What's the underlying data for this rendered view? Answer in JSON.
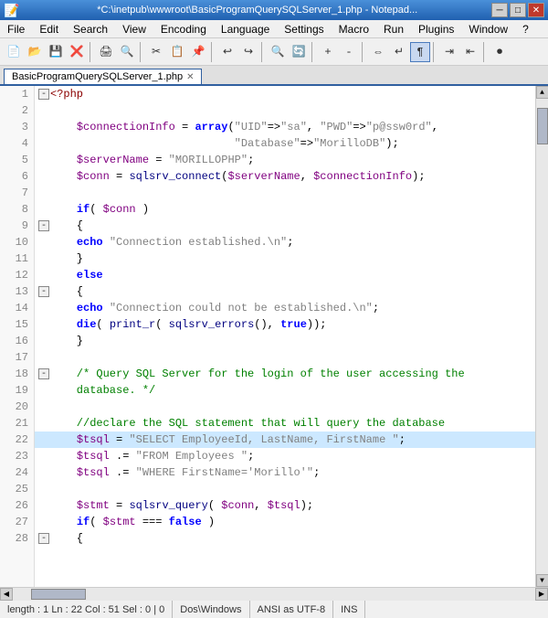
{
  "titleBar": {
    "title": "*C:\\inetpub\\wwwroot\\BasicProgramQuerySQLServer_1.php - Notepad...",
    "minimizeLabel": "─",
    "maximizeLabel": "□",
    "closeLabel": "✕"
  },
  "menuBar": {
    "items": [
      "File",
      "Edit",
      "Search",
      "View",
      "Encoding",
      "Language",
      "Settings",
      "Macro",
      "Run",
      "Plugins",
      "Window",
      "?"
    ]
  },
  "tab": {
    "label": "BasicProgramQuerySQLServer_1.php",
    "closeLabel": "✕"
  },
  "statusBar": {
    "position": "length : 1   Ln : 22   Col : 51   Sel : 0 | 0",
    "lineEnding": "Dos\\Windows",
    "encoding": "ANSI as UTF-8",
    "mode": "INS"
  },
  "lines": [
    {
      "num": 1,
      "fold": "-",
      "code": "<?php",
      "type": "tag"
    },
    {
      "num": 2,
      "fold": "",
      "code": "",
      "type": "plain"
    },
    {
      "num": 3,
      "fold": "",
      "code": "    $connectionInfo = array(\"UID\"=>\"sa\", \"PWD\"=>\"p@ssw0rd\",",
      "type": "mixed"
    },
    {
      "num": 4,
      "fold": "",
      "code": "                            \"Database\"=>\"MorilloDB\");",
      "type": "mixed"
    },
    {
      "num": 5,
      "fold": "",
      "code": "    $serverName = \"MORILLOPHP\";",
      "type": "mixed"
    },
    {
      "num": 6,
      "fold": "",
      "code": "    $conn = sqlsrv_connect($serverName, $connectionInfo);",
      "type": "mixed"
    },
    {
      "num": 7,
      "fold": "",
      "code": "",
      "type": "plain"
    },
    {
      "num": 8,
      "fold": "",
      "code": "    if( $conn )",
      "type": "mixed"
    },
    {
      "num": 9,
      "fold": "-",
      "code": "    {",
      "type": "plain"
    },
    {
      "num": 10,
      "fold": "",
      "code": "    echo \"Connection established.\\n\";",
      "type": "mixed"
    },
    {
      "num": 11,
      "fold": "",
      "code": "    }",
      "type": "plain"
    },
    {
      "num": 12,
      "fold": "",
      "code": "    else",
      "type": "kw"
    },
    {
      "num": 13,
      "fold": "-",
      "code": "    {",
      "type": "plain"
    },
    {
      "num": 14,
      "fold": "",
      "code": "    echo \"Connection could not be established.\\n\";",
      "type": "mixed"
    },
    {
      "num": 15,
      "fold": "",
      "code": "    die( print_r( sqlsrv_errors(), true));",
      "type": "mixed"
    },
    {
      "num": 16,
      "fold": "",
      "code": "    }",
      "type": "plain"
    },
    {
      "num": 17,
      "fold": "",
      "code": "",
      "type": "plain"
    },
    {
      "num": 18,
      "fold": "-",
      "code": "    /* Query SQL Server for the login of the user accessing the",
      "type": "comment"
    },
    {
      "num": 19,
      "fold": "",
      "code": "    database. */",
      "type": "comment"
    },
    {
      "num": 20,
      "fold": "",
      "code": "",
      "type": "plain"
    },
    {
      "num": 21,
      "fold": "",
      "code": "    //declare the SQL statement that will query the database",
      "type": "comment"
    },
    {
      "num": 22,
      "fold": "",
      "code": "    $tsql = \"SELECT EmployeeId, LastName, FirstName \";",
      "type": "mixed",
      "highlight": true
    },
    {
      "num": 23,
      "fold": "",
      "code": "    $tsql .= \"FROM Employees \";",
      "type": "mixed"
    },
    {
      "num": 24,
      "fold": "",
      "code": "    $tsql .= \"WHERE FirstName='Morillo'\";",
      "type": "mixed"
    },
    {
      "num": 25,
      "fold": "",
      "code": "",
      "type": "plain"
    },
    {
      "num": 26,
      "fold": "",
      "code": "    $stmt = sqlsrv_query( $conn, $tsql);",
      "type": "mixed"
    },
    {
      "num": 27,
      "fold": "",
      "code": "    if( $stmt === false )",
      "type": "mixed"
    },
    {
      "num": 28,
      "fold": "-",
      "code": "    {",
      "type": "plain"
    }
  ]
}
